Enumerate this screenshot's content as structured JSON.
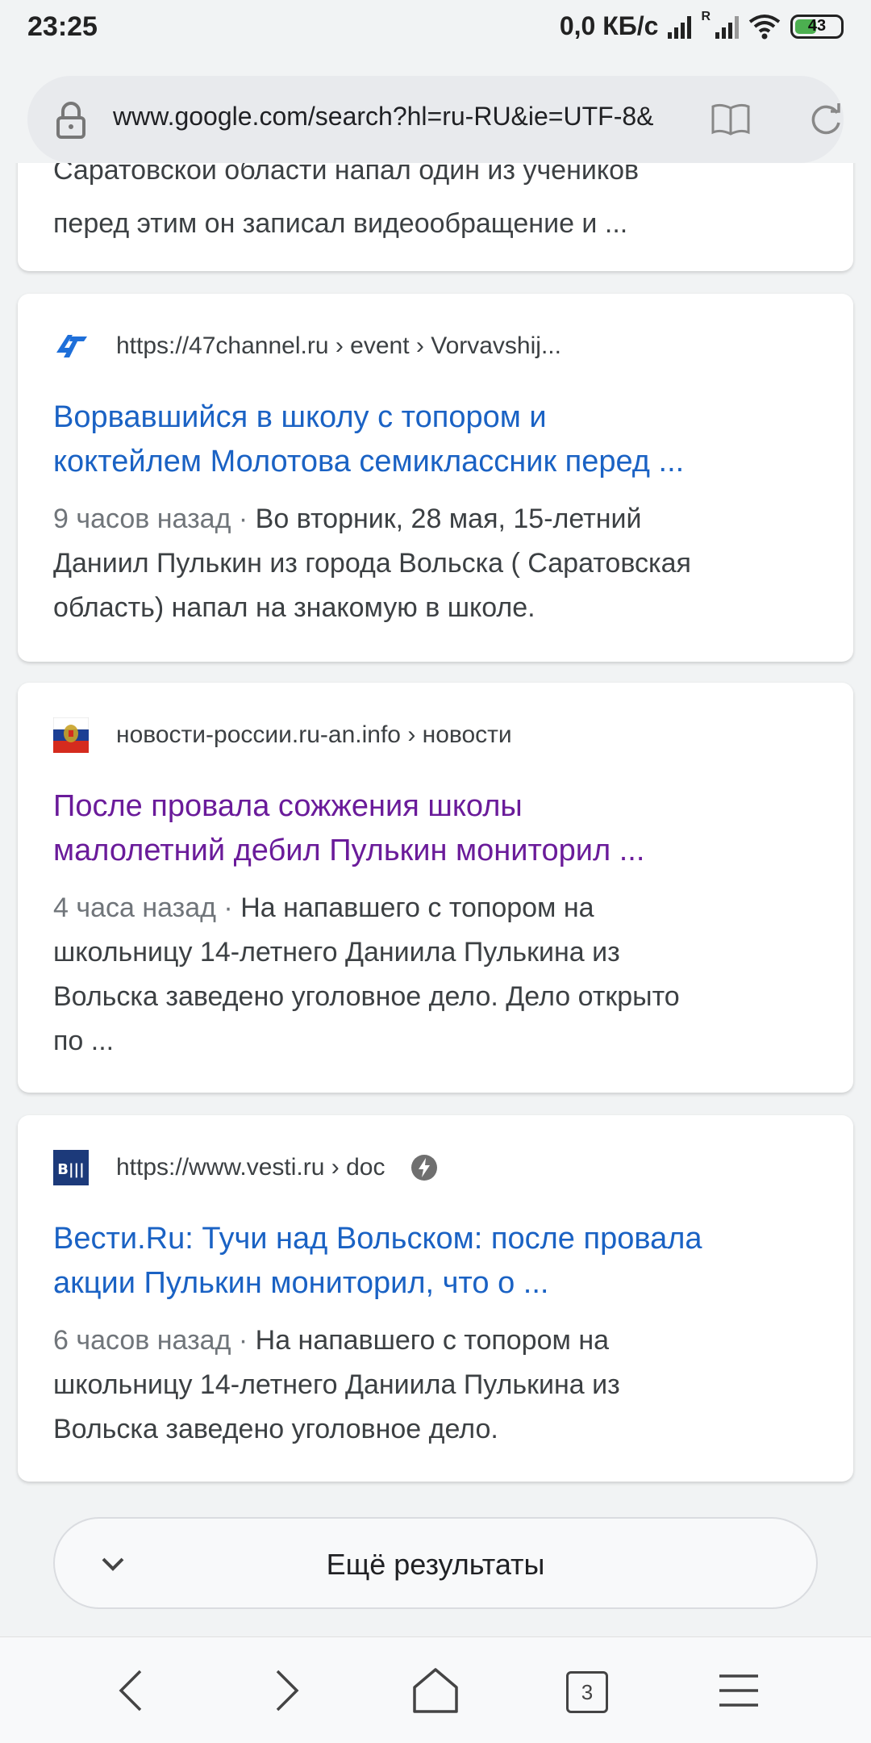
{
  "status_bar": {
    "time": "23:25",
    "network_speed": "0,0 КБ/с",
    "roaming_mark": "R",
    "battery": "43"
  },
  "browser": {
    "url": "www.google.com/search?hl=ru-RU&ie=UTF-8&",
    "tab_count": "3"
  },
  "results": [
    {
      "partial_hidden_line": "Саратовской области напал один из учеников",
      "partial_visible_line": "перед этим он записал видеообращение и ..."
    },
    {
      "source": "https://47channel.ru › event › Vorvavshij...",
      "favicon": "47channel-logo-icon",
      "title_line1": "Ворвавшийся в школу с топором и",
      "title_line2": "коктейлем Молотова семиклассник перед ...",
      "date": "9 часов назад · ",
      "snippet_lines": [
        "Во вторник, 28 мая, 15-летний",
        "Даниил Пулькин из города Вольска ( Саратовская",
        "область) напал на знакомую в школе."
      ]
    },
    {
      "source": "новости-россии.ru-an.info › новости",
      "favicon": "russia-coat-of-arms-icon",
      "title_line1": "После провала сожжения школы",
      "title_line2": "малолетний дебил Пулькин мониторил ...",
      "date": "4 часа назад · ",
      "snippet_lines": [
        "На напавшего с топором на",
        "школьницу 14-летнего Даниила Пулькина из",
        "Вольска заведено уголовное дело. Дело открыто",
        "по ..."
      ]
    },
    {
      "source": "https://www.vesti.ru › doc",
      "favicon": "vesti-logo-icon",
      "favicon_text": "В|||",
      "title_line1": "Вести.Ru: Тучи над Вольском: после провала",
      "title_line2": "акции Пулькин мониторил, что о ...",
      "date": "6 часов назад · ",
      "snippet_lines": [
        "На напавшего с топором на",
        "школьницу 14-летнего Даниила Пулькина из",
        "Вольска заведено уголовное дело."
      ]
    }
  ],
  "more_results_label": "Ещё результаты",
  "colors": {
    "link": "#1a62c4",
    "visited_link": "#6a1b9a",
    "snippet": "#3c4043",
    "date": "#70757a"
  }
}
